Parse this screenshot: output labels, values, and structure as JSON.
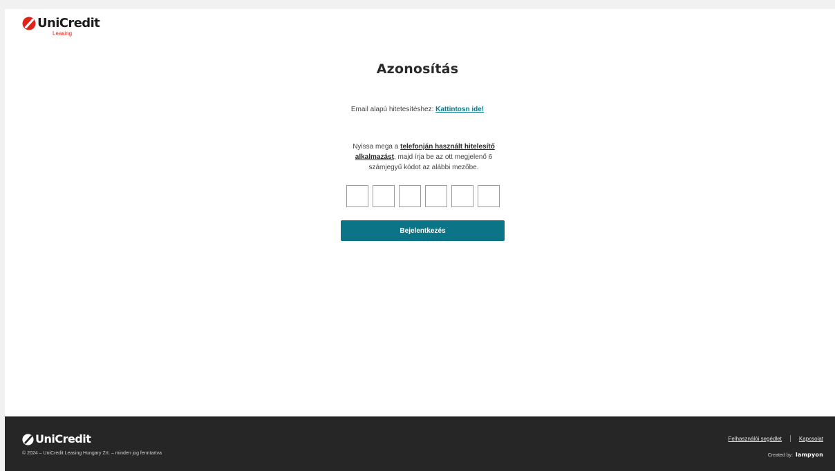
{
  "header": {
    "logo_text": "UniCredit",
    "logo_subtext": "Leasing"
  },
  "main": {
    "title": "Azonosítás",
    "email_prompt": "Email alapú hitetesítéshez:",
    "email_link": "Kattintosn ide!",
    "instructions_before": "Nyissa mega a ",
    "instructions_link": "telefonján használt hitelesítő alkalmazást",
    "instructions_after": ", majd írja be az ott megjelenő 6 számjegyű kódot az alábbi mezőbe.",
    "code_digits": [
      "",
      "",
      "",
      "",
      "",
      ""
    ],
    "login_button": "Bejelentkezés"
  },
  "footer": {
    "logo_text": "UniCredit",
    "copyright": "© 2024 – UniCredit Leasing Hungary Zrt. – minden jog fenntartva",
    "links": {
      "user_guide": "Felhasználói segédlet",
      "contact": "Kapcsolat"
    },
    "created_by_label": "Created by:",
    "created_by_brand": "lampyon"
  },
  "colors": {
    "brand_red": "#e2231a",
    "accent_teal": "#0b7486",
    "footer_bg": "#262626"
  }
}
